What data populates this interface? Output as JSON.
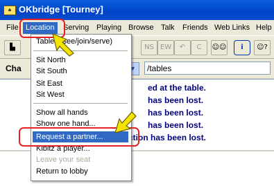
{
  "window": {
    "title": "OKbridge [Tourney]"
  },
  "menubar": {
    "items": [
      "File",
      "Location",
      "Serving",
      "Playing",
      "Browse",
      "Talk",
      "Friends",
      "Web Links",
      "Help"
    ]
  },
  "toolbar": {
    "labels": {
      "ns": "NS",
      "ew": "EW",
      "c": "C",
      "info": "i"
    }
  },
  "channel": {
    "label": "Cha",
    "command": "/tables"
  },
  "messages": [
    "ed at the table.",
    "has been lost.",
    "has been lost.",
    "has been lost.",
    "ction has been lost."
  ],
  "location_menu": {
    "tables": "Tables (see/join/serve)",
    "sit_north": "Sit North",
    "sit_south": "Sit South",
    "sit_east": "Sit East",
    "sit_west": "Sit West",
    "show_all_hands": "Show all hands",
    "show_one_hand": "Show one hand...",
    "request_partner": "Request a partner...",
    "kibitz": "Kibitz a player...",
    "leave_seat": "Leave your seat",
    "return_lobby": "Return to lobby"
  }
}
